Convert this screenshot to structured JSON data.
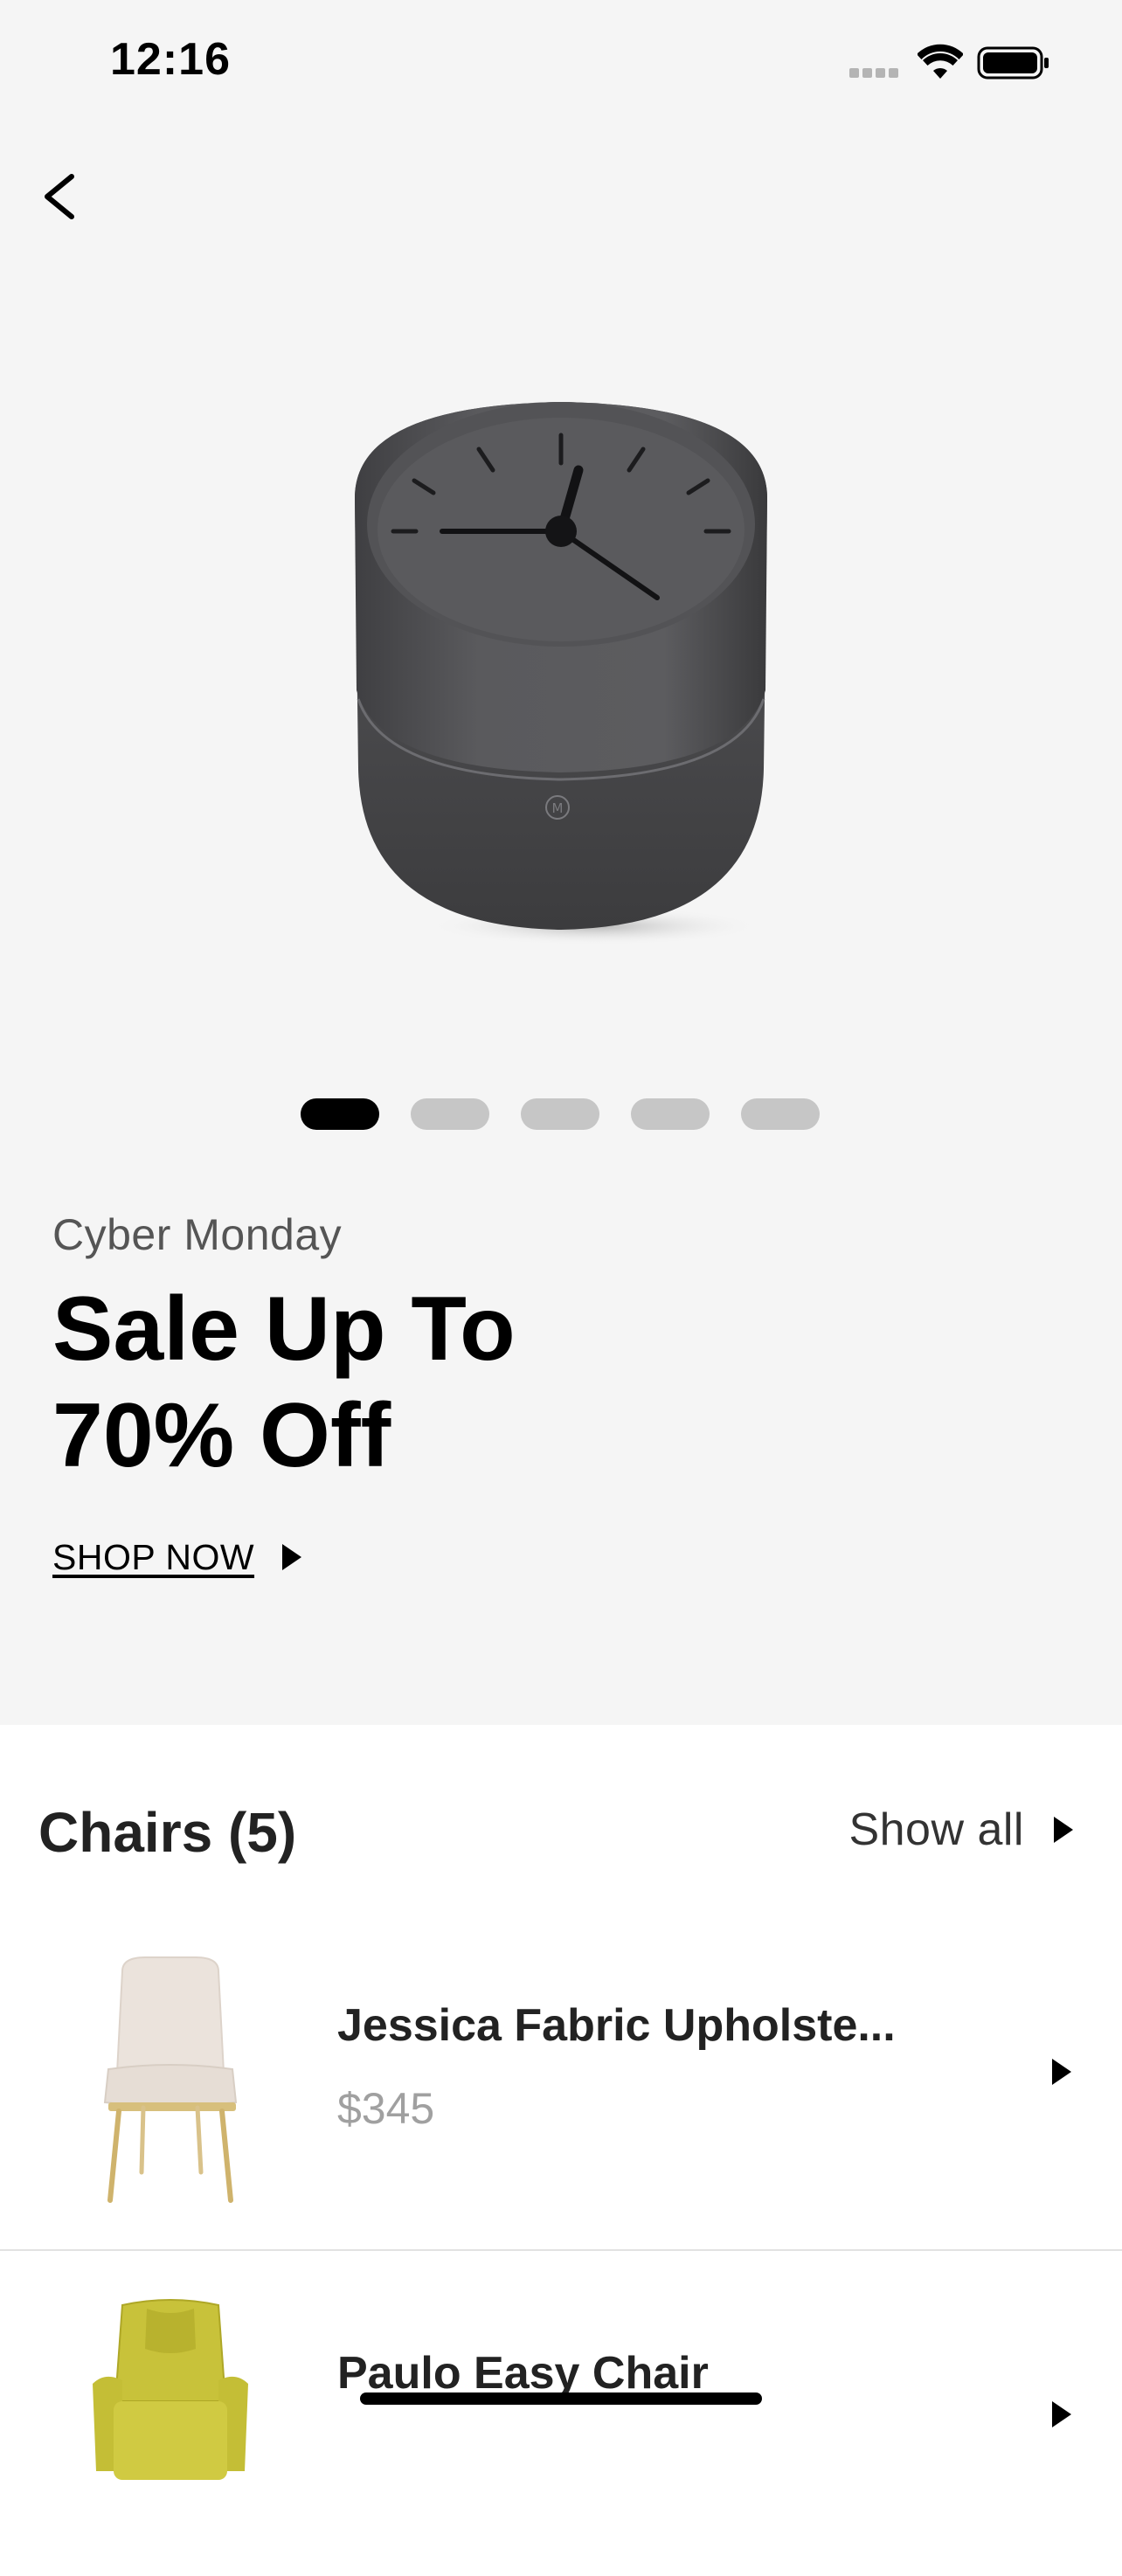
{
  "status_bar": {
    "time": "12:16"
  },
  "icons": {
    "back": "chevron-left-icon",
    "arrow": "play-triangle-icon",
    "wifi": "wifi-icon",
    "battery": "battery-icon",
    "signal": "cellular-signal-icon"
  },
  "colors": {
    "hero_background": "#f5f5f5",
    "dot_active": "#000000",
    "dot_inactive": "#c6c6c6",
    "price": "#a0a0a0"
  },
  "carousel": {
    "dot_count": 5,
    "active_index": 0
  },
  "promo": {
    "subtitle": "Cyber Monday",
    "title_line1": "Sale Up To",
    "title_line2": "70% Off",
    "cta_label": "SHOP NOW"
  },
  "section": {
    "title": "Chairs (5)",
    "show_all_label": "Show all"
  },
  "products": [
    {
      "name": "Jessica Fabric Upholste...",
      "price": "$345",
      "thumb_color": "#ebe3dc"
    },
    {
      "name": "Paulo Easy Chair",
      "price": "",
      "thumb_color": "#c8c23a"
    }
  ]
}
